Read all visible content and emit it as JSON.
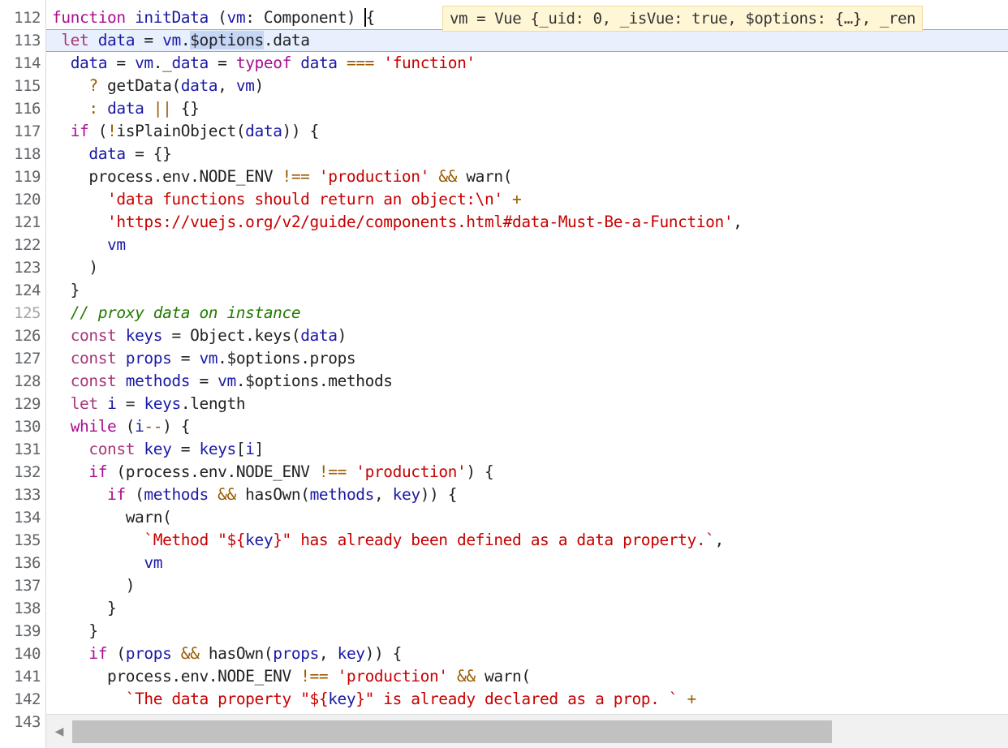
{
  "editor": {
    "inline_value": "vm = Vue {_uid: 0, _isVue: true, $options: {…}, _ren",
    "lines": [
      {
        "n": "112",
        "tokens": [
          [
            "kw",
            "function"
          ],
          [
            "pl",
            " "
          ],
          [
            "var",
            "initData"
          ],
          [
            "pl",
            " ("
          ],
          [
            "var",
            "vm"
          ],
          [
            "pl",
            ": Component) "
          ],
          [
            "cur",
            "{"
          ]
        ]
      },
      {
        "n": "113",
        "hl": true,
        "tokens": [
          [
            "pl",
            " "
          ],
          [
            "kw2",
            "let"
          ],
          [
            "pl",
            " "
          ],
          [
            "var",
            "data"
          ],
          [
            "pl",
            " = "
          ],
          [
            "var",
            "vm"
          ],
          [
            "pl",
            "."
          ],
          [
            "sel",
            "$options"
          ],
          [
            "pl",
            ".data"
          ]
        ]
      },
      {
        "n": "114",
        "tokens": [
          [
            "pl",
            "  "
          ],
          [
            "var",
            "data"
          ],
          [
            "pl",
            " = "
          ],
          [
            "var",
            "vm"
          ],
          [
            "pl",
            "._"
          ],
          [
            "var",
            "data"
          ],
          [
            "pl",
            " = "
          ],
          [
            "kw",
            "typeof"
          ],
          [
            "pl",
            " "
          ],
          [
            "var",
            "data"
          ],
          [
            "pl",
            " "
          ],
          [
            "op",
            "==="
          ],
          [
            "pl",
            " "
          ],
          [
            "str",
            "'function'"
          ]
        ]
      },
      {
        "n": "115",
        "tokens": [
          [
            "pl",
            "    "
          ],
          [
            "op",
            "?"
          ],
          [
            "pl",
            " getData("
          ],
          [
            "var",
            "data"
          ],
          [
            "pl",
            ", "
          ],
          [
            "var",
            "vm"
          ],
          [
            "pl",
            ")"
          ]
        ]
      },
      {
        "n": "116",
        "tokens": [
          [
            "pl",
            "    "
          ],
          [
            "op",
            ":"
          ],
          [
            "pl",
            " "
          ],
          [
            "var",
            "data"
          ],
          [
            "pl",
            " "
          ],
          [
            "op",
            "||"
          ],
          [
            "pl",
            " {}"
          ]
        ]
      },
      {
        "n": "117",
        "tokens": [
          [
            "pl",
            "  "
          ],
          [
            "kw",
            "if"
          ],
          [
            "pl",
            " ("
          ],
          [
            "op",
            "!"
          ],
          [
            "pl",
            "isPlainObject("
          ],
          [
            "var",
            "data"
          ],
          [
            "pl",
            ")) {"
          ]
        ]
      },
      {
        "n": "118",
        "tokens": [
          [
            "pl",
            "    "
          ],
          [
            "var",
            "data"
          ],
          [
            "pl",
            " = {}"
          ]
        ]
      },
      {
        "n": "119",
        "tokens": [
          [
            "pl",
            "    process.env.NODE_ENV "
          ],
          [
            "op",
            "!=="
          ],
          [
            "pl",
            " "
          ],
          [
            "str",
            "'production'"
          ],
          [
            "pl",
            " "
          ],
          [
            "op",
            "&&"
          ],
          [
            "pl",
            " warn("
          ]
        ]
      },
      {
        "n": "120",
        "tokens": [
          [
            "pl",
            "      "
          ],
          [
            "str",
            "'data functions should return an object:\\n'"
          ],
          [
            "pl",
            " "
          ],
          [
            "op",
            "+"
          ]
        ]
      },
      {
        "n": "121",
        "tokens": [
          [
            "pl",
            "      "
          ],
          [
            "str",
            "'https://vuejs.org/v2/guide/components.html#data-Must-Be-a-Function'"
          ],
          [
            "pl",
            ","
          ]
        ]
      },
      {
        "n": "122",
        "tokens": [
          [
            "pl",
            "      "
          ],
          [
            "var",
            "vm"
          ]
        ]
      },
      {
        "n": "123",
        "tokens": [
          [
            "pl",
            "    )"
          ]
        ]
      },
      {
        "n": "124",
        "tokens": [
          [
            "pl",
            "  }"
          ]
        ]
      },
      {
        "n": "125",
        "dim": true,
        "tokens": [
          [
            "pl",
            "  "
          ],
          [
            "cm",
            "// proxy data on instance"
          ]
        ]
      },
      {
        "n": "126",
        "tokens": [
          [
            "pl",
            "  "
          ],
          [
            "kw2",
            "const"
          ],
          [
            "pl",
            " "
          ],
          [
            "var",
            "keys"
          ],
          [
            "pl",
            " = Object.keys("
          ],
          [
            "var",
            "data"
          ],
          [
            "pl",
            ")"
          ]
        ]
      },
      {
        "n": "127",
        "tokens": [
          [
            "pl",
            "  "
          ],
          [
            "kw2",
            "const"
          ],
          [
            "pl",
            " "
          ],
          [
            "var",
            "props"
          ],
          [
            "pl",
            " = "
          ],
          [
            "var",
            "vm"
          ],
          [
            "pl",
            ".$options.props"
          ]
        ]
      },
      {
        "n": "128",
        "tokens": [
          [
            "pl",
            "  "
          ],
          [
            "kw2",
            "const"
          ],
          [
            "pl",
            " "
          ],
          [
            "var",
            "methods"
          ],
          [
            "pl",
            " = "
          ],
          [
            "var",
            "vm"
          ],
          [
            "pl",
            ".$options.methods"
          ]
        ]
      },
      {
        "n": "129",
        "tokens": [
          [
            "pl",
            "  "
          ],
          [
            "kw2",
            "let"
          ],
          [
            "pl",
            " "
          ],
          [
            "var",
            "i"
          ],
          [
            "pl",
            " = "
          ],
          [
            "var",
            "keys"
          ],
          [
            "pl",
            ".length"
          ]
        ]
      },
      {
        "n": "130",
        "tokens": [
          [
            "pl",
            "  "
          ],
          [
            "kw",
            "while"
          ],
          [
            "pl",
            " ("
          ],
          [
            "var",
            "i"
          ],
          [
            "op",
            "--"
          ],
          [
            "pl",
            ") {"
          ]
        ]
      },
      {
        "n": "131",
        "tokens": [
          [
            "pl",
            "    "
          ],
          [
            "kw2",
            "const"
          ],
          [
            "pl",
            " "
          ],
          [
            "var",
            "key"
          ],
          [
            "pl",
            " = "
          ],
          [
            "var",
            "keys"
          ],
          [
            "pl",
            "["
          ],
          [
            "var",
            "i"
          ],
          [
            "pl",
            "]"
          ]
        ]
      },
      {
        "n": "132",
        "tokens": [
          [
            "pl",
            "    "
          ],
          [
            "kw",
            "if"
          ],
          [
            "pl",
            " (process.env.NODE_ENV "
          ],
          [
            "op",
            "!=="
          ],
          [
            "pl",
            " "
          ],
          [
            "str",
            "'production'"
          ],
          [
            "pl",
            ") {"
          ]
        ]
      },
      {
        "n": "133",
        "tokens": [
          [
            "pl",
            "      "
          ],
          [
            "kw",
            "if"
          ],
          [
            "pl",
            " ("
          ],
          [
            "var",
            "methods"
          ],
          [
            "pl",
            " "
          ],
          [
            "op",
            "&&"
          ],
          [
            "pl",
            " hasOwn("
          ],
          [
            "var",
            "methods"
          ],
          [
            "pl",
            ", "
          ],
          [
            "var",
            "key"
          ],
          [
            "pl",
            ")) {"
          ]
        ]
      },
      {
        "n": "134",
        "tokens": [
          [
            "pl",
            "        warn("
          ]
        ]
      },
      {
        "n": "135",
        "tokens": [
          [
            "pl",
            "          "
          ],
          [
            "str",
            "`Method \"${"
          ],
          [
            "var",
            "key"
          ],
          [
            "str",
            "}\" has already been defined as a data property.`"
          ],
          [
            "pl",
            ","
          ]
        ]
      },
      {
        "n": "136",
        "tokens": [
          [
            "pl",
            "          "
          ],
          [
            "var",
            "vm"
          ]
        ]
      },
      {
        "n": "137",
        "tokens": [
          [
            "pl",
            "        )"
          ]
        ]
      },
      {
        "n": "138",
        "tokens": [
          [
            "pl",
            "      }"
          ]
        ]
      },
      {
        "n": "139",
        "tokens": [
          [
            "pl",
            "    }"
          ]
        ]
      },
      {
        "n": "140",
        "tokens": [
          [
            "pl",
            "    "
          ],
          [
            "kw",
            "if"
          ],
          [
            "pl",
            " ("
          ],
          [
            "var",
            "props"
          ],
          [
            "pl",
            " "
          ],
          [
            "op",
            "&&"
          ],
          [
            "pl",
            " hasOwn("
          ],
          [
            "var",
            "props"
          ],
          [
            "pl",
            ", "
          ],
          [
            "var",
            "key"
          ],
          [
            "pl",
            ")) {"
          ]
        ]
      },
      {
        "n": "141",
        "tokens": [
          [
            "pl",
            "      process.env.NODE_ENV "
          ],
          [
            "op",
            "!=="
          ],
          [
            "pl",
            " "
          ],
          [
            "str",
            "'production'"
          ],
          [
            "pl",
            " "
          ],
          [
            "op",
            "&&"
          ],
          [
            "pl",
            " warn("
          ]
        ]
      },
      {
        "n": "142",
        "tokens": [
          [
            "pl",
            "        "
          ],
          [
            "str",
            "`The data property \"${"
          ],
          [
            "var",
            "key"
          ],
          [
            "str",
            "}\" is already declared as a prop. `"
          ],
          [
            "pl",
            " "
          ],
          [
            "op",
            "+"
          ]
        ]
      },
      {
        "n": "143",
        "tokens": []
      }
    ]
  },
  "scrollbar": {
    "left_arrow_icon": "◀"
  }
}
